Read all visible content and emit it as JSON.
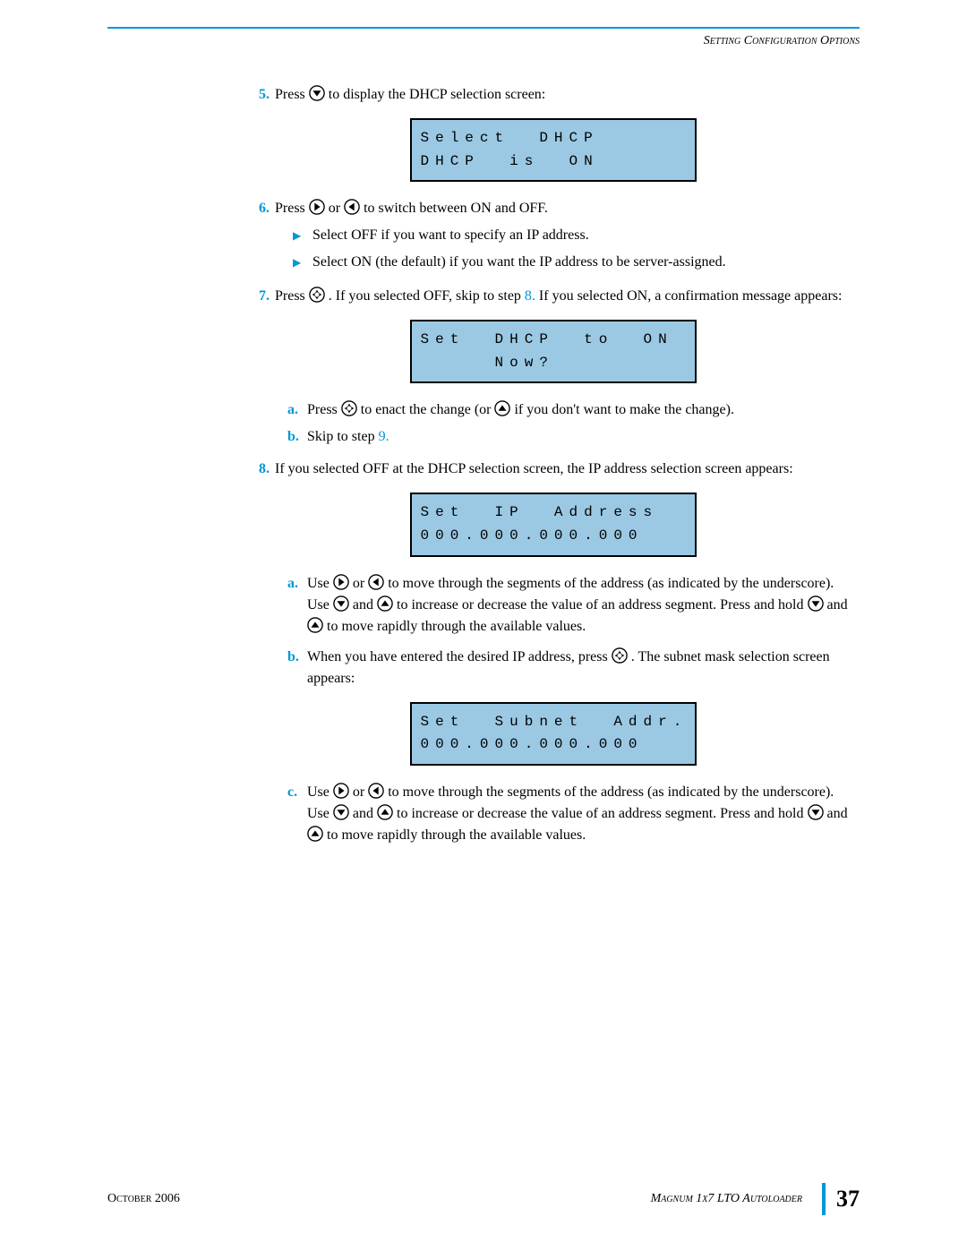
{
  "header": {
    "section_title": "Setting Configuration Options"
  },
  "steps": {
    "s5": {
      "num": "5.",
      "text_before": "Press ",
      "text_after": " to display the DHCP selection screen:"
    },
    "lcd1": {
      "line1": "Select  DHCP",
      "line2": "DHCP  is  ON"
    },
    "s6": {
      "num": "6.",
      "t1": "Press ",
      "t2": " or ",
      "t3": " to switch between ON and OFF.",
      "bullet1": "Select OFF if you want to specify an IP address.",
      "bullet2": "Select ON (the default) if you want the IP address to be server-assigned."
    },
    "s7": {
      "num": "7.",
      "t1": "Press ",
      "t2": ". If you selected OFF, skip to step ",
      "link8": "8.",
      "t3": " If you selected ON, a confirmation message appears:"
    },
    "lcd2": {
      "line1": "Set  DHCP  to  ON",
      "line2": "     Now?"
    },
    "s7a": {
      "letter": "a.",
      "t1": "Press ",
      "t2": " to enact the change (or ",
      "t3": " if you don't want to make the change)."
    },
    "s7b": {
      "letter": "b.",
      "t1": "Skip to step ",
      "link9": "9."
    },
    "s8": {
      "num": "8.",
      "t1": "If you selected OFF at the DHCP selection screen, the IP address selection screen appears:"
    },
    "lcd3": {
      "line1": "Set  IP  Address",
      "line2": "000.000.000.000"
    },
    "s8a": {
      "letter": "a.",
      "t1": "Use ",
      "t2": " or ",
      "t3": " to move through the segments of the address (as indicated by the underscore). Use ",
      "t4": " and ",
      "t5": " to increase or decrease the value of an address segment. Press and hold ",
      "t6": " and ",
      "t7": " to move rapidly through the available values."
    },
    "s8b": {
      "letter": "b.",
      "t1": "When you have entered the desired IP address, press ",
      "t2": ". The subnet mask selection screen appears:"
    },
    "lcd4": {
      "line1": "Set  Subnet  Addr.",
      "line2": "000.000.000.000"
    },
    "s8c": {
      "letter": "c.",
      "t1": "Use ",
      "t2": " or ",
      "t3": " to move through the segments of the address (as indicated by the underscore). Use ",
      "t4": " and ",
      "t5": " to increase or decrease the value of an address segment. Press and hold ",
      "t6": " and ",
      "t7": " to move rapidly through the available values."
    }
  },
  "footer": {
    "date": "October 2006",
    "product": "Magnum 1x7 LTO Autoloader",
    "page": "37"
  }
}
